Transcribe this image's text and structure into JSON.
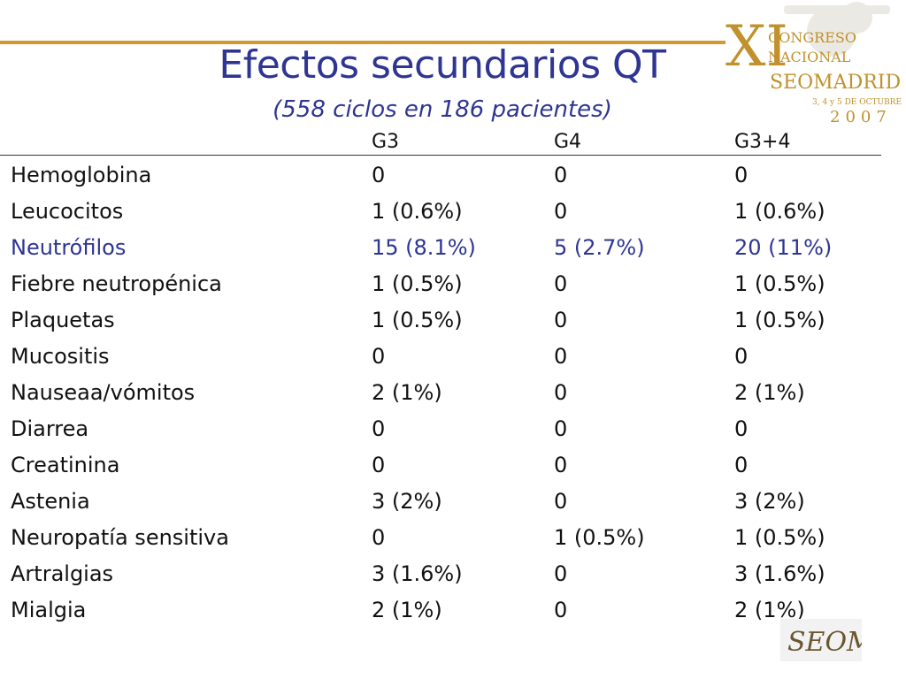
{
  "logo": {
    "text_big": "XI",
    "line1": "CONGRESO",
    "line2": "NACIONAL",
    "line3": "SEOMADRID",
    "line4": "3, 4 y 5 DE OCTUBRE",
    "line5": "2007",
    "corner_mark": "SEOM"
  },
  "title": "Efectos secundarios QT",
  "subtitle": "(558 ciclos en 186 pacientes)",
  "table": {
    "columns": [
      "",
      "G3",
      "G4",
      "G3+4"
    ],
    "rows": [
      {
        "label": "Hemoglobina",
        "g3": "0",
        "g4": "0",
        "g34": "0"
      },
      {
        "label": "Leucocitos",
        "g3": "1 (0.6%)",
        "g4": "0",
        "g34": "1 (0.6%)"
      },
      {
        "label": "Neutrófilos",
        "g3": "15 (8.1%)",
        "g4": "5 (2.7%)",
        "g34": "20 (11%)",
        "highlight": true
      },
      {
        "label": "Fiebre neutropénica",
        "g3": "1 (0.5%)",
        "g4": "0",
        "g34": "1 (0.5%)"
      },
      {
        "label": "Plaquetas",
        "g3": "1 (0.5%)",
        "g4": "0",
        "g34": "1 (0.5%)"
      },
      {
        "label": "Mucositis",
        "g3": "0",
        "g4": "0",
        "g34": "0"
      },
      {
        "label": "Nauseaa/vómitos",
        "g3": "2 (1%)",
        "g4": "0",
        "g34": "2 (1%)"
      },
      {
        "label": "Diarrea",
        "g3": "0",
        "g4": "0",
        "g34": "0"
      },
      {
        "label": "Creatinina",
        "g3": "0",
        "g4": "0",
        "g34": "0"
      },
      {
        "label": "Astenia",
        "g3": "3 (2%)",
        "g4": "0",
        "g34": "3 (2%)"
      },
      {
        "label": "Neuropatía sensitiva",
        "g3": "0",
        "g4": "1 (0.5%)",
        "g34": "1 (0.5%)"
      },
      {
        "label": "Artralgias",
        "g3": "3 (1.6%)",
        "g4": "0",
        "g34": "3 (1.6%)"
      },
      {
        "label": "Mialgia",
        "g3": "2 (1%)",
        "g4": "0",
        "g34": "2 (1%)"
      }
    ]
  },
  "colors": {
    "title": "#2e3592",
    "highlight": "#2e3592",
    "accent_gold": "#d19a2c",
    "text": "#111111"
  }
}
